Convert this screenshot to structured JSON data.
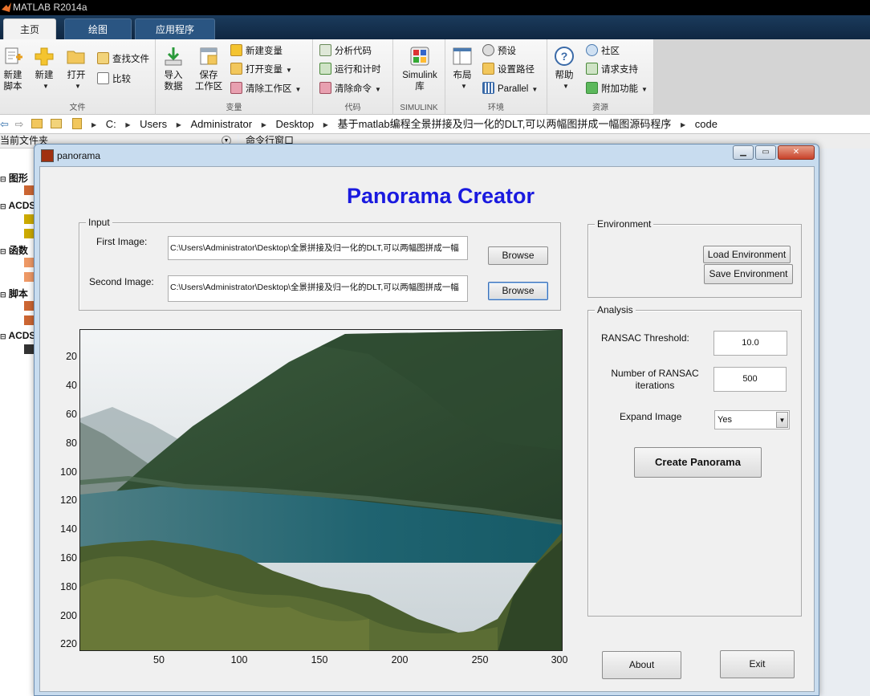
{
  "matlab": {
    "title": "MATLAB R2014a",
    "tabs": [
      {
        "label": "主页"
      },
      {
        "label": "绘图"
      },
      {
        "label": "应用程序"
      }
    ],
    "ribbon": {
      "file": {
        "title": "文件",
        "new_script": "新建\n脚本",
        "new": "新建",
        "open": "打开",
        "find_files": "查找文件",
        "compare": "比较"
      },
      "variable": {
        "title": "变量",
        "import": "导入\n数据",
        "save_ws": "保存\n工作区",
        "new_var": "新建变量",
        "open_var": "打开变量",
        "clear_ws": "清除工作区"
      },
      "code": {
        "title": "代码",
        "analyze": "分析代码",
        "run_time": "运行和计时",
        "clear_cmd": "清除命令"
      },
      "simulink": {
        "title": "SIMULINK",
        "label": "Simulink\n库"
      },
      "env": {
        "title": "环境",
        "layout": "布局",
        "prefs": "预设",
        "set_path": "设置路径",
        "parallel": "Parallel"
      },
      "res": {
        "title": "资源",
        "help": "帮助",
        "community": "社区",
        "support": "请求支持",
        "addons": "附加功能"
      }
    },
    "address": [
      "C:",
      "Users",
      "Administrator",
      "Desktop",
      "基于matlab编程全景拼接及归一化的DLT,可以两幅图拼成一幅图源码程序",
      "code"
    ],
    "current_folder_label": "当前文件夹",
    "command_window_label": "命令行窗口",
    "sidebar_items": [
      "图形",
      "ACDS",
      "函数",
      "脚本",
      "ACDS"
    ]
  },
  "window": {
    "title": "panorama",
    "app_title": "Panorama Creator",
    "input": {
      "legend": "Input",
      "first_label": "First Image:",
      "first_path": "C:\\Users\\Administrator\\Desktop\\全景拼接及归一化的DLT,可以两幅图拼成一幅",
      "second_label": "Second Image:",
      "second_path": "C:\\Users\\Administrator\\Desktop\\全景拼接及归一化的DLT,可以两幅图拼成一幅",
      "browse_label": "Browse"
    },
    "environment": {
      "legend": "Environment",
      "load_label": "Load Environment",
      "save_label": "Save Environment"
    },
    "analysis": {
      "legend": "Analysis",
      "threshold_label": "RANSAC Threshold:",
      "threshold_value": "10.0",
      "iterations_label": "Number of RANSAC\niterations",
      "iterations_value": "500",
      "expand_label": "Expand Image",
      "expand_value": "Yes",
      "create_label": "Create Panorama"
    },
    "about_label": "About",
    "exit_label": "Exit",
    "axes": {
      "y_ticks": [
        "20",
        "40",
        "60",
        "80",
        "100",
        "120",
        "140",
        "160",
        "180",
        "200",
        "220"
      ],
      "x_ticks": [
        "50",
        "100",
        "150",
        "200",
        "250",
        "300"
      ]
    }
  }
}
